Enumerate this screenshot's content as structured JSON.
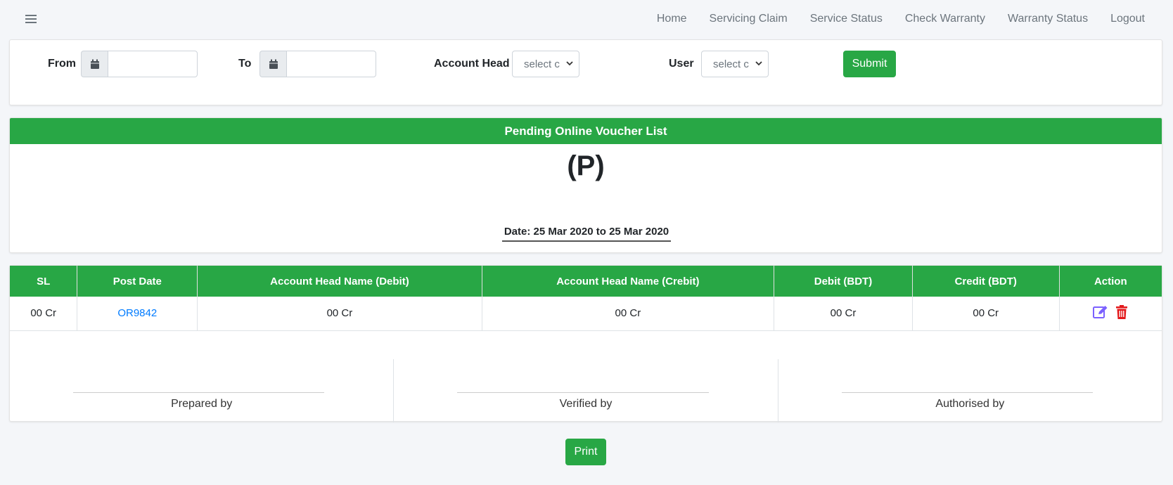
{
  "nav": {
    "items": [
      "Home",
      "Servicing Claim",
      "Service Status",
      "Check Warranty",
      "Warranty Status",
      "Logout"
    ]
  },
  "filter": {
    "from_label": "From",
    "to_label": "To",
    "from_value": "",
    "to_value": "",
    "account_head_label": "Account Head",
    "account_head_selected": "select c",
    "user_label": "User",
    "user_selected": "select c",
    "submit_label": "Submit"
  },
  "report": {
    "title": "Pending Online Voucher List",
    "logo_text": "(P)",
    "date_range": "Date: 25 Mar 2020 to 25 Mar 2020"
  },
  "table": {
    "headers": [
      "SL",
      "Post Date",
      "Account Head Name (Debit)",
      "Account Head Name (Crebit)",
      "Debit (BDT)",
      "Credit (BDT)",
      "Action"
    ],
    "rows": [
      {
        "sl": "00 Cr",
        "post_date": "OR9842",
        "debit_head": "00 Cr",
        "credit_head": "00 Cr",
        "debit": "00 Cr",
        "credit": "00 Cr"
      }
    ]
  },
  "signatures": [
    "Prepared by",
    "Verified by",
    "Authorised by"
  ],
  "print_label": "Print",
  "colors": {
    "accent": "#28a745",
    "link": "#007bff",
    "edit_icon": "#7b61ff",
    "delete_icon": "#e3191b"
  }
}
